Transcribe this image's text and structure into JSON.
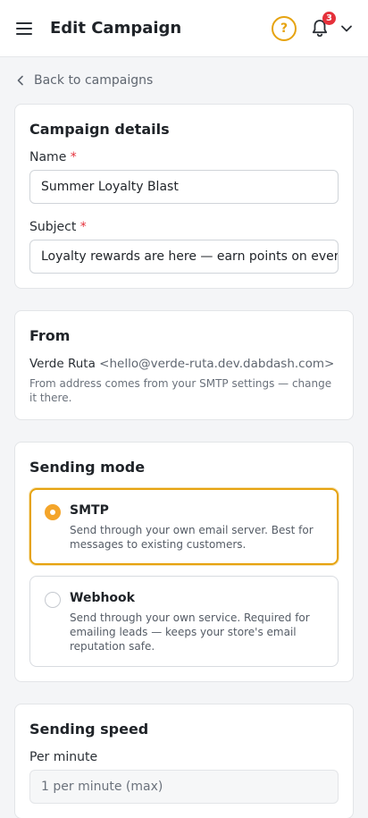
{
  "header": {
    "title": "Edit Campaign",
    "help_symbol": "?",
    "notification_count": "3"
  },
  "back_link": {
    "label": "Back to campaigns"
  },
  "details": {
    "title": "Campaign details",
    "name_label": "Name",
    "name_value": "Summer Loyalty Blast",
    "subject_label": "Subject",
    "subject_value": "Loyalty rewards are here — earn points on every",
    "required_mark": "*"
  },
  "from": {
    "title": "From",
    "sender_name": "Verde Ruta",
    "sender_email": "<hello@verde-ruta.dev.dabdash.com>",
    "hint": "From address comes from your SMTP settings — change it there."
  },
  "sending_mode": {
    "title": "Sending mode",
    "options": [
      {
        "label": "SMTP",
        "description": "Send through your own email server. Best for messages to existing customers.",
        "selected": true
      },
      {
        "label": "Webhook",
        "description": "Send through your own service. Required for emailing leads — keeps your store's email reputation safe.",
        "selected": false
      }
    ]
  },
  "sending_speed": {
    "title": "Sending speed",
    "per_minute_label": "Per minute",
    "per_minute_value": "1 per minute (max)"
  },
  "colors": {
    "accent": "#e6a310",
    "radio_selected": "#f4a52a",
    "badge": "#e5303a"
  }
}
